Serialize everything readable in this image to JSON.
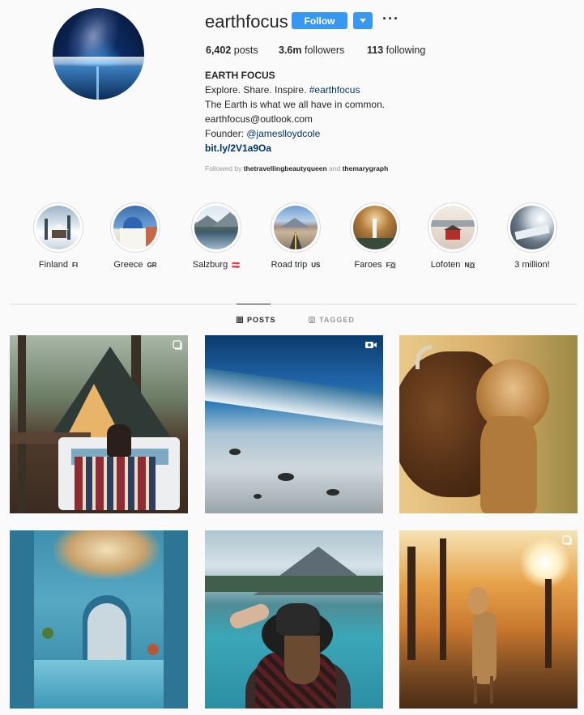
{
  "profile": {
    "username": "earthfocus",
    "follow_label": "Follow",
    "more_label": "···",
    "stats": {
      "posts_count": "6,402",
      "posts_label": "posts",
      "followers_count": "3.6m",
      "followers_label": "followers",
      "following_count": "113",
      "following_label": "following"
    },
    "bio": {
      "name": "EARTH FOCUS",
      "line1_prefix": "Explore. Share. Inspire. ",
      "line1_hashtag": "#earthfocus",
      "line2": "The Earth is what we all have in common.",
      "line3": "earthfocus@outlook.com",
      "line4_prefix": "Founder: ",
      "line4_mention": "@jameslloydcole",
      "link": "bit.ly/2V1a9Oa"
    },
    "followed_by": {
      "prefix": "Followed by ",
      "user1": "thetravellingbeautyqueen",
      "conjunction": " and ",
      "user2": "themarygraph"
    }
  },
  "highlights": [
    {
      "name": "Finland",
      "flag": "FI",
      "icon": "winter-cabin"
    },
    {
      "name": "Greece",
      "flag": "GR",
      "icon": "santorini-church"
    },
    {
      "name": "Salzburg",
      "flag": "🇦🇹",
      "icon": "mountain-lake"
    },
    {
      "name": "Road trip",
      "flag": "US",
      "icon": "desert-road"
    },
    {
      "name": "Faroes",
      "flag": "F🇴",
      "icon": "waterfall-cliff"
    },
    {
      "name": "Lofoten",
      "flag": "N🇴",
      "icon": "red-cabin"
    },
    {
      "name": "3 million!",
      "flag": "",
      "icon": "glacier"
    }
  ],
  "tabs": {
    "posts_label": "POSTS",
    "tagged_label": "TAGGED",
    "active": "posts"
  },
  "posts": [
    {
      "subject": "a-frame-cabin-hot-tub",
      "badge": "carousel-icon"
    },
    {
      "subject": "ocean-wave-beach",
      "badge": "video-icon"
    },
    {
      "subject": "bison-with-calf",
      "badge": ""
    },
    {
      "subject": "blue-alley-chefchaouen",
      "badge": ""
    },
    {
      "subject": "woman-hat-lake",
      "badge": ""
    },
    {
      "subject": "deer-autumn-park",
      "badge": "carousel-icon"
    }
  ],
  "colors": {
    "follow_blue": "#3897f0",
    "link_navy": "#003569",
    "muted_grey": "#999999",
    "border_grey": "#dbdbdb"
  }
}
